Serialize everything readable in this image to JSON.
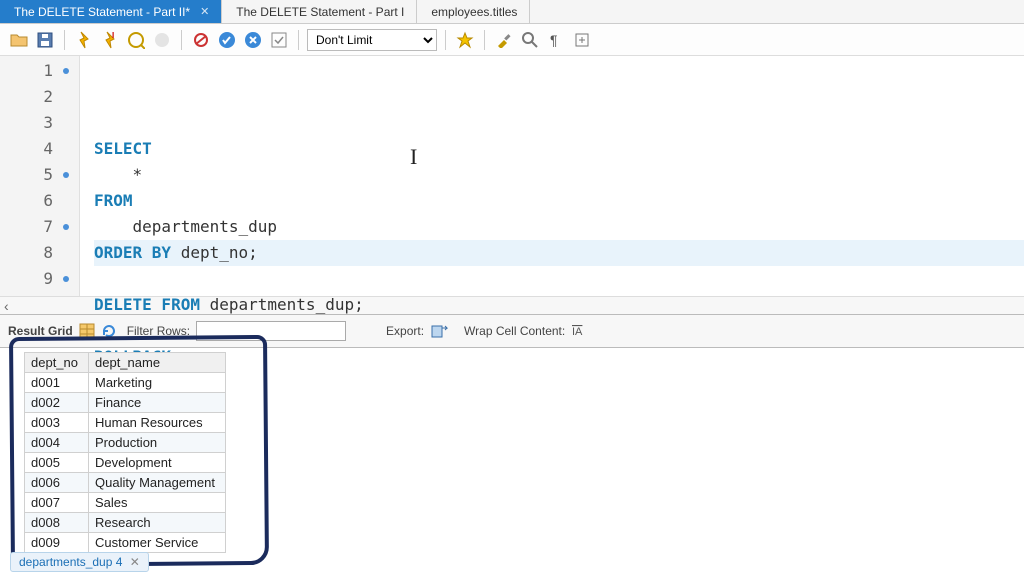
{
  "tabs": [
    {
      "label": "The DELETE Statement - Part II*",
      "active": true,
      "closeable": true
    },
    {
      "label": "The DELETE Statement - Part I",
      "active": false,
      "closeable": false
    },
    {
      "label": "employees.titles",
      "active": false,
      "closeable": false
    }
  ],
  "toolbar": {
    "limit_label": "Don't Limit"
  },
  "editor": {
    "lines": [
      {
        "n": "1",
        "dot": true,
        "tokens": [
          {
            "t": "SELECT",
            "c": "kw"
          }
        ]
      },
      {
        "n": "2",
        "dot": false,
        "tokens": [
          {
            "t": "    *",
            "c": "id"
          }
        ]
      },
      {
        "n": "3",
        "dot": false,
        "tokens": [
          {
            "t": "FROM",
            "c": "kw"
          }
        ]
      },
      {
        "n": "4",
        "dot": false,
        "tokens": [
          {
            "t": "    departments_dup",
            "c": "id"
          }
        ]
      },
      {
        "n": "5",
        "dot": true,
        "hl": true,
        "tokens": [
          {
            "t": "ORDER BY",
            "c": "kw"
          },
          {
            "t": " dept_no",
            "c": "id"
          },
          {
            "t": ";",
            "c": "op"
          }
        ]
      },
      {
        "n": "6",
        "dot": false,
        "tokens": []
      },
      {
        "n": "7",
        "dot": true,
        "tokens": [
          {
            "t": "DELETE FROM",
            "c": "kw"
          },
          {
            "t": " departments_dup",
            "c": "id"
          },
          {
            "t": ";",
            "c": "op"
          }
        ]
      },
      {
        "n": "8",
        "dot": false,
        "tokens": []
      },
      {
        "n": "9",
        "dot": true,
        "tokens": [
          {
            "t": "ROLLBACK",
            "c": "kw"
          },
          {
            "t": ";",
            "c": "op"
          }
        ]
      }
    ]
  },
  "result_bar": {
    "title": "Result Grid",
    "filter_label": "Filter Rows:",
    "export_label": "Export:",
    "wrap_label": "Wrap Cell Content:"
  },
  "grid": {
    "columns": [
      "dept_no",
      "dept_name"
    ],
    "rows": [
      [
        "d001",
        "Marketing"
      ],
      [
        "d002",
        "Finance"
      ],
      [
        "d003",
        "Human Resources"
      ],
      [
        "d004",
        "Production"
      ],
      [
        "d005",
        "Development"
      ],
      [
        "d006",
        "Quality Management"
      ],
      [
        "d007",
        "Sales"
      ],
      [
        "d008",
        "Research"
      ],
      [
        "d009",
        "Customer Service"
      ]
    ]
  },
  "bottom_tab": {
    "label": "departments_dup 4"
  }
}
